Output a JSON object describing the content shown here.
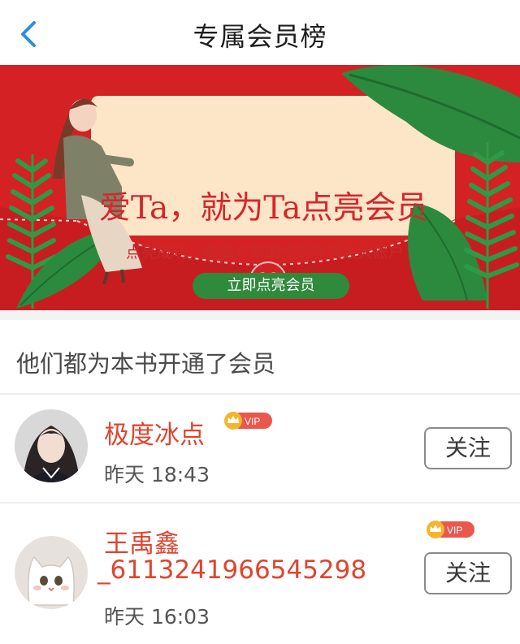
{
  "header": {
    "back_icon": "chevron-left-icon",
    "title": "专属会员榜"
  },
  "banner": {
    "headline": "爱Ta，就为Ta点亮会员",
    "subline": "点亮成功，收益立刻同步到作者大大账户",
    "cta_label": "立即点亮会员",
    "colors": {
      "red": "#d42224",
      "letter": "#fde5c7",
      "leaf": "#2b8a3e",
      "cta": "#2f8a3c"
    }
  },
  "section": {
    "title": "他们都为本书开通了会员"
  },
  "members": [
    {
      "name_lines": [
        "极度冰点"
      ],
      "badge": "VIP",
      "time": "昨天 18:43",
      "follow_label": "关注"
    },
    {
      "name_lines": [
        "王禹鑫",
        "_6113241966545298"
      ],
      "badge": "VIP",
      "time": "昨天 16:03",
      "follow_label": "关注"
    }
  ]
}
